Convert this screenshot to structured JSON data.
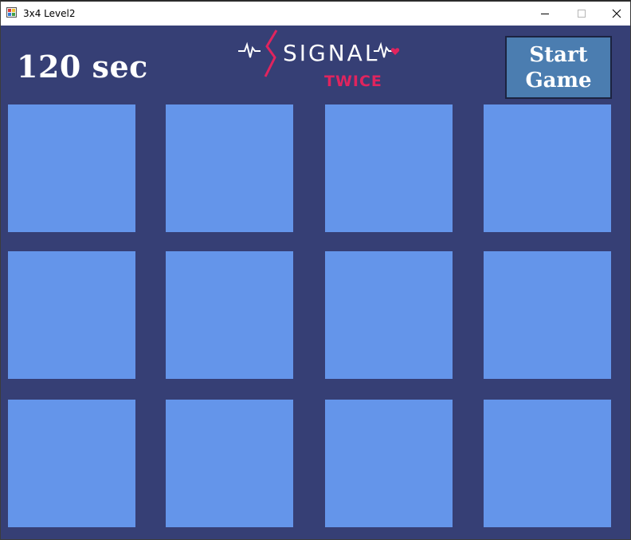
{
  "window": {
    "title": "3x4 Level2",
    "icon": "app-icon",
    "controls": [
      "minimize-icon",
      "maximize-icon",
      "close-icon"
    ]
  },
  "game": {
    "timer_text": "120 sec",
    "logo": {
      "main_text": "SIGNAL",
      "sub_text": "TWICE"
    },
    "start_button_label": "Start\nGame",
    "grid": {
      "rows": 3,
      "columns": 4,
      "card_count": 12
    }
  },
  "colors": {
    "background": "#363f75",
    "card": "#6495ea",
    "start_button": "#4b7db0",
    "logo_accent": "#e0245e",
    "text": "#ffffff"
  }
}
